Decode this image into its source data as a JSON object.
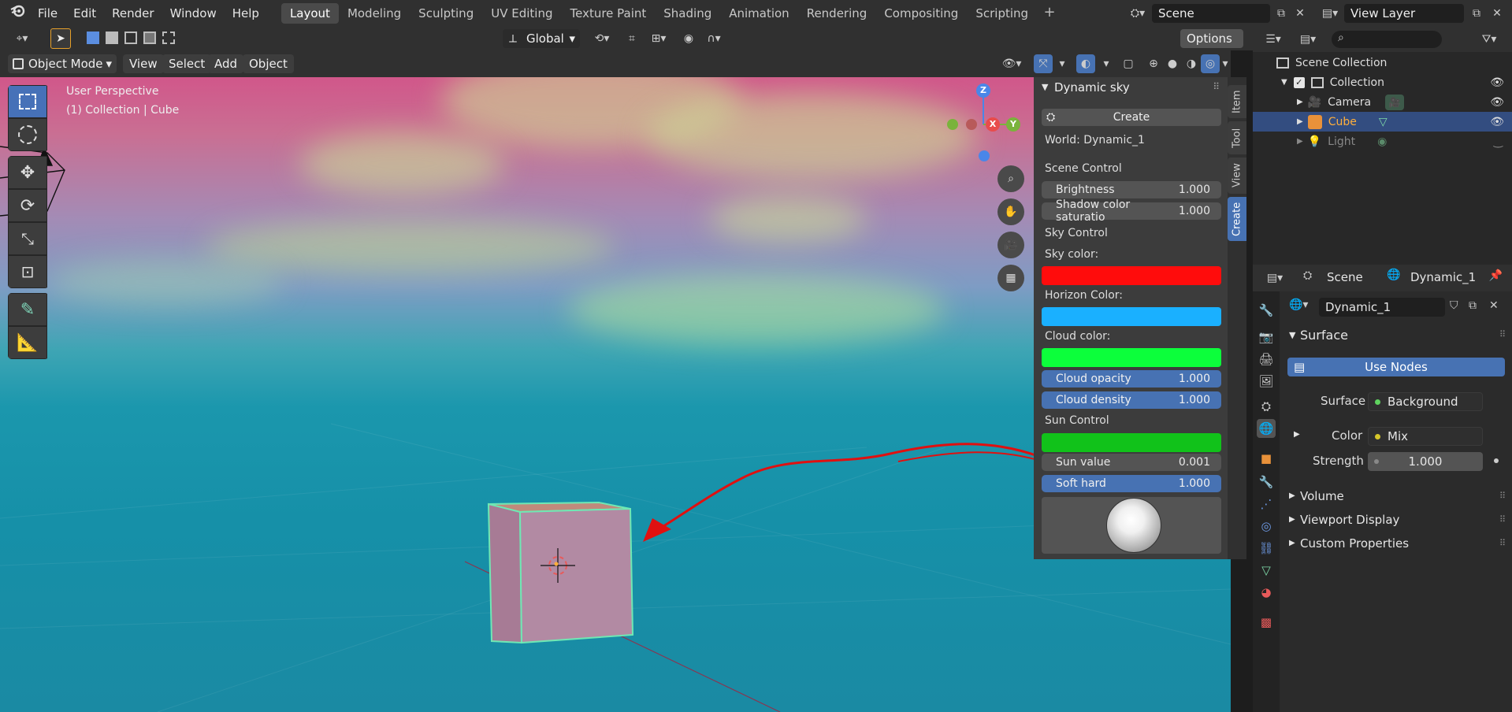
{
  "menu": [
    "File",
    "Edit",
    "Render",
    "Window",
    "Help"
  ],
  "workspaces": [
    "Layout",
    "Modeling",
    "Sculpting",
    "UV Editing",
    "Texture Paint",
    "Shading",
    "Animation",
    "Rendering",
    "Compositing",
    "Scripting"
  ],
  "active_workspace": "Layout",
  "scene_name": "Scene",
  "view_layer": "View Layer",
  "toolbar": {
    "transform_orientation": "Global",
    "options": "Options"
  },
  "header": {
    "mode": "Object Mode",
    "view": "View",
    "select": "Select",
    "add": "Add",
    "object": "Object"
  },
  "viewport": {
    "perspective": "User Perspective",
    "context": "(1) Collection | Cube",
    "gizmo": {
      "z": "Z",
      "x": "X",
      "y": "Y"
    }
  },
  "npanel": {
    "title": "Dynamic sky",
    "create_button": "Create",
    "world": "World: Dynamic_1",
    "scene_control": "Scene Control",
    "brightness": {
      "label": "Brightness",
      "value": "1.000"
    },
    "shadow": {
      "label": "Shadow color saturatio",
      "value": "1.000"
    },
    "sky_control": "Sky Control",
    "sky_color_label": "Sky color:",
    "horizon_color_label": "Horizon Color:",
    "cloud_color_label": "Cloud color:",
    "cloud_opacity": {
      "label": "Cloud opacity",
      "value": "1.000"
    },
    "cloud_density": {
      "label": "Cloud density",
      "value": "1.000"
    },
    "sun_control": "Sun Control",
    "sun_value": {
      "label": "Sun value",
      "value": "0.001"
    },
    "soft_hard": {
      "label": "Soft hard",
      "value": "1.000"
    },
    "colors": {
      "sky": "#ff0c0c",
      "horizon": "#1ab0ff",
      "cloud": "#0cff3b",
      "sun": "#11c21a"
    },
    "tabs": [
      "Item",
      "Tool",
      "View",
      "Create"
    ],
    "active_tab": "Create"
  },
  "outliner": {
    "root": "Scene Collection",
    "collection": "Collection",
    "items": [
      {
        "name": "Camera"
      },
      {
        "name": "Cube"
      },
      {
        "name": "Light"
      }
    ]
  },
  "properties": {
    "scene": "Scene",
    "world": "Dynamic_1",
    "world_field": "Dynamic_1",
    "surface_panel": "Surface",
    "use_nodes": "Use Nodes",
    "surface_label": "Surface",
    "surface_value": "Background",
    "color_label": "Color",
    "color_value": "Mix",
    "strength_label": "Strength",
    "strength_value": "1.000",
    "volume": "Volume",
    "viewport_display": "Viewport Display",
    "custom_properties": "Custom Properties"
  }
}
